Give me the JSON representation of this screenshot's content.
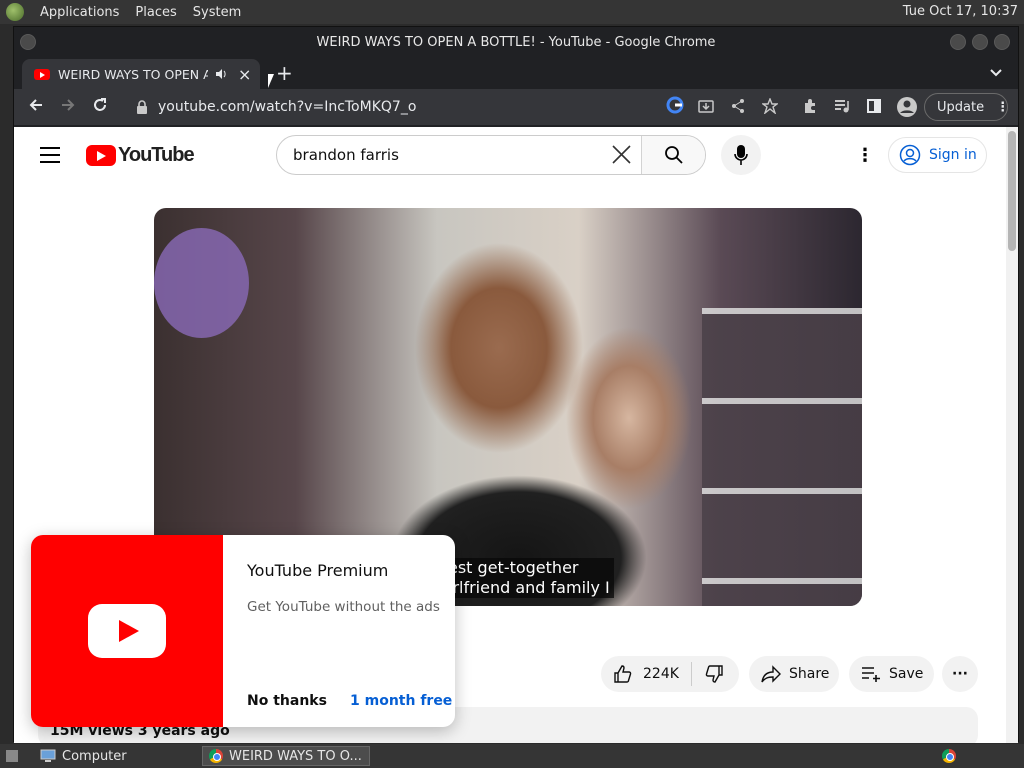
{
  "os": {
    "menu": [
      "Applications",
      "Places",
      "System"
    ],
    "clock": "Tue Oct 17, 10:37"
  },
  "window": {
    "title": "WEIRD WAYS TO OPEN A BOTTLE! - YouTube - Google Chrome"
  },
  "tab": {
    "title": "WEIRD WAYS TO OPEN A",
    "close": "×",
    "new_tab": "+"
  },
  "address": {
    "url": "youtube.com/watch?v=IncToMKQ7_o",
    "update_label": "Update"
  },
  "youtube": {
    "wordmark": "YouTube",
    "search_query": "brandon farris",
    "signin_label": "Sign in",
    "captions": [
      "est get-together",
      "irlfriend and family I"
    ],
    "likes": "224K",
    "share_label": "Share",
    "save_label": "Save",
    "views_label": "15M views  3 years ago"
  },
  "promo": {
    "title": "YouTube Premium",
    "description": "Get YouTube without the ads",
    "no_thanks": "No thanks",
    "trial": "1 month free"
  },
  "taskbar": {
    "items": [
      "Computer",
      "WEIRD WAYS TO O..."
    ]
  },
  "colors": {
    "brand_red": "#ff0000",
    "link_blue": "#065fd4"
  }
}
